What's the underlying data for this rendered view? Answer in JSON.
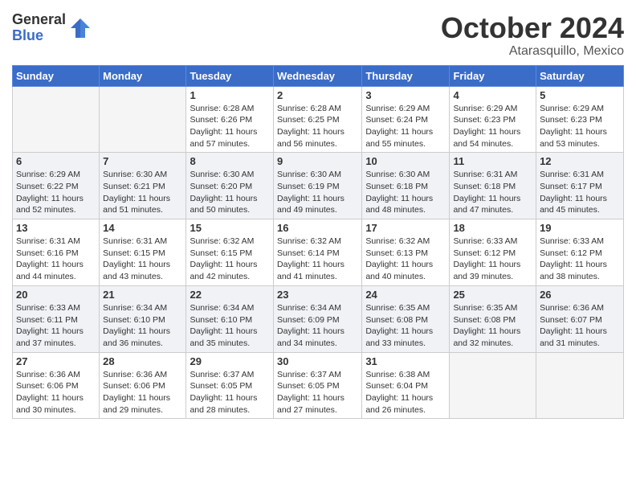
{
  "header": {
    "logo_general": "General",
    "logo_blue": "Blue",
    "month_title": "October 2024",
    "location": "Atarasquillo, Mexico"
  },
  "days_of_week": [
    "Sunday",
    "Monday",
    "Tuesday",
    "Wednesday",
    "Thursday",
    "Friday",
    "Saturday"
  ],
  "weeks": [
    [
      {
        "day": "",
        "info": "",
        "empty": true
      },
      {
        "day": "",
        "info": "",
        "empty": true
      },
      {
        "day": "1",
        "info": "Sunrise: 6:28 AM\nSunset: 6:26 PM\nDaylight: 11 hours and 57 minutes."
      },
      {
        "day": "2",
        "info": "Sunrise: 6:28 AM\nSunset: 6:25 PM\nDaylight: 11 hours and 56 minutes."
      },
      {
        "day": "3",
        "info": "Sunrise: 6:29 AM\nSunset: 6:24 PM\nDaylight: 11 hours and 55 minutes."
      },
      {
        "day": "4",
        "info": "Sunrise: 6:29 AM\nSunset: 6:23 PM\nDaylight: 11 hours and 54 minutes."
      },
      {
        "day": "5",
        "info": "Sunrise: 6:29 AM\nSunset: 6:23 PM\nDaylight: 11 hours and 53 minutes."
      }
    ],
    [
      {
        "day": "6",
        "info": "Sunrise: 6:29 AM\nSunset: 6:22 PM\nDaylight: 11 hours and 52 minutes."
      },
      {
        "day": "7",
        "info": "Sunrise: 6:30 AM\nSunset: 6:21 PM\nDaylight: 11 hours and 51 minutes."
      },
      {
        "day": "8",
        "info": "Sunrise: 6:30 AM\nSunset: 6:20 PM\nDaylight: 11 hours and 50 minutes."
      },
      {
        "day": "9",
        "info": "Sunrise: 6:30 AM\nSunset: 6:19 PM\nDaylight: 11 hours and 49 minutes."
      },
      {
        "day": "10",
        "info": "Sunrise: 6:30 AM\nSunset: 6:18 PM\nDaylight: 11 hours and 48 minutes."
      },
      {
        "day": "11",
        "info": "Sunrise: 6:31 AM\nSunset: 6:18 PM\nDaylight: 11 hours and 47 minutes."
      },
      {
        "day": "12",
        "info": "Sunrise: 6:31 AM\nSunset: 6:17 PM\nDaylight: 11 hours and 45 minutes."
      }
    ],
    [
      {
        "day": "13",
        "info": "Sunrise: 6:31 AM\nSunset: 6:16 PM\nDaylight: 11 hours and 44 minutes."
      },
      {
        "day": "14",
        "info": "Sunrise: 6:31 AM\nSunset: 6:15 PM\nDaylight: 11 hours and 43 minutes."
      },
      {
        "day": "15",
        "info": "Sunrise: 6:32 AM\nSunset: 6:15 PM\nDaylight: 11 hours and 42 minutes."
      },
      {
        "day": "16",
        "info": "Sunrise: 6:32 AM\nSunset: 6:14 PM\nDaylight: 11 hours and 41 minutes."
      },
      {
        "day": "17",
        "info": "Sunrise: 6:32 AM\nSunset: 6:13 PM\nDaylight: 11 hours and 40 minutes."
      },
      {
        "day": "18",
        "info": "Sunrise: 6:33 AM\nSunset: 6:12 PM\nDaylight: 11 hours and 39 minutes."
      },
      {
        "day": "19",
        "info": "Sunrise: 6:33 AM\nSunset: 6:12 PM\nDaylight: 11 hours and 38 minutes."
      }
    ],
    [
      {
        "day": "20",
        "info": "Sunrise: 6:33 AM\nSunset: 6:11 PM\nDaylight: 11 hours and 37 minutes."
      },
      {
        "day": "21",
        "info": "Sunrise: 6:34 AM\nSunset: 6:10 PM\nDaylight: 11 hours and 36 minutes."
      },
      {
        "day": "22",
        "info": "Sunrise: 6:34 AM\nSunset: 6:10 PM\nDaylight: 11 hours and 35 minutes."
      },
      {
        "day": "23",
        "info": "Sunrise: 6:34 AM\nSunset: 6:09 PM\nDaylight: 11 hours and 34 minutes."
      },
      {
        "day": "24",
        "info": "Sunrise: 6:35 AM\nSunset: 6:08 PM\nDaylight: 11 hours and 33 minutes."
      },
      {
        "day": "25",
        "info": "Sunrise: 6:35 AM\nSunset: 6:08 PM\nDaylight: 11 hours and 32 minutes."
      },
      {
        "day": "26",
        "info": "Sunrise: 6:36 AM\nSunset: 6:07 PM\nDaylight: 11 hours and 31 minutes."
      }
    ],
    [
      {
        "day": "27",
        "info": "Sunrise: 6:36 AM\nSunset: 6:06 PM\nDaylight: 11 hours and 30 minutes."
      },
      {
        "day": "28",
        "info": "Sunrise: 6:36 AM\nSunset: 6:06 PM\nDaylight: 11 hours and 29 minutes."
      },
      {
        "day": "29",
        "info": "Sunrise: 6:37 AM\nSunset: 6:05 PM\nDaylight: 11 hours and 28 minutes."
      },
      {
        "day": "30",
        "info": "Sunrise: 6:37 AM\nSunset: 6:05 PM\nDaylight: 11 hours and 27 minutes."
      },
      {
        "day": "31",
        "info": "Sunrise: 6:38 AM\nSunset: 6:04 PM\nDaylight: 11 hours and 26 minutes."
      },
      {
        "day": "",
        "info": "",
        "empty": true
      },
      {
        "day": "",
        "info": "",
        "empty": true
      }
    ]
  ]
}
